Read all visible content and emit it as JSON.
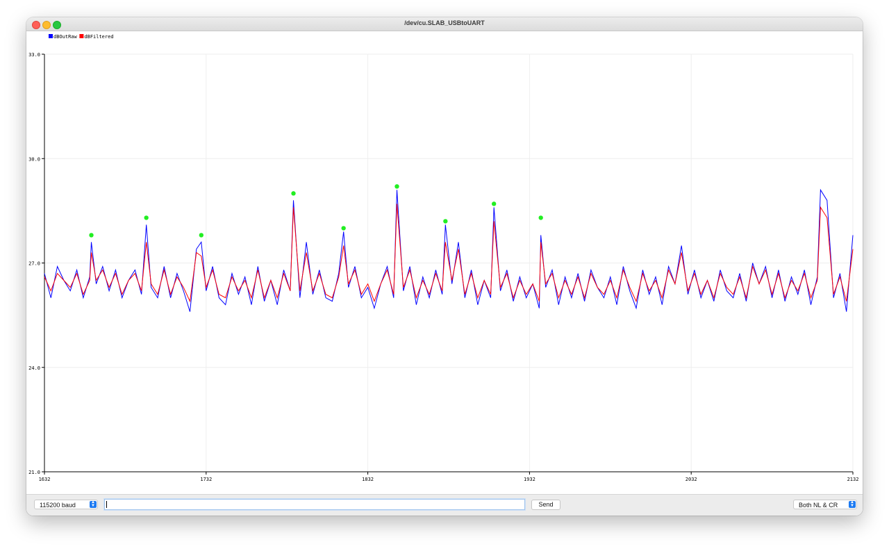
{
  "window": {
    "title": "/dev/cu.SLAB_USBtoUART"
  },
  "toolbar": {
    "baud_label": "115200 baud",
    "input_value": "",
    "send_label": "Send",
    "line_ending_label": "Both NL & CR"
  },
  "chart_data": {
    "type": "line",
    "xlim": [
      1632,
      2132
    ],
    "ylim": [
      21.0,
      33.0
    ],
    "xticks": [
      1632,
      1732,
      1832,
      1932,
      2032,
      2132
    ],
    "yticks": [
      21.0,
      24.0,
      27.0,
      30.0,
      33.0
    ],
    "xtick_labels": [
      "1632",
      "1732",
      "1832",
      "1932",
      "2032",
      "2132"
    ],
    "ytick_labels": [
      "21.0",
      "24.0",
      "27.0",
      "30.0",
      "33.0"
    ],
    "grid": true,
    "legend_position": "top-left",
    "series": [
      {
        "name": "dBOutRaw",
        "color": "#0000ff",
        "x": [
          1632,
          1636,
          1640,
          1644,
          1648,
          1652,
          1656,
          1660,
          1661,
          1664,
          1668,
          1672,
          1676,
          1680,
          1684,
          1688,
          1692,
          1695,
          1698,
          1702,
          1706,
          1710,
          1714,
          1718,
          1722,
          1726,
          1729,
          1732,
          1736,
          1740,
          1744,
          1748,
          1752,
          1756,
          1760,
          1764,
          1768,
          1772,
          1776,
          1780,
          1784,
          1786,
          1790,
          1794,
          1798,
          1802,
          1806,
          1810,
          1814,
          1817,
          1820,
          1824,
          1828,
          1832,
          1836,
          1840,
          1844,
          1848,
          1850,
          1854,
          1858,
          1862,
          1866,
          1870,
          1874,
          1878,
          1880,
          1884,
          1888,
          1892,
          1896,
          1900,
          1904,
          1908,
          1910,
          1914,
          1918,
          1922,
          1926,
          1930,
          1934,
          1938,
          1939,
          1942,
          1946,
          1950,
          1954,
          1958,
          1962,
          1966,
          1970,
          1974,
          1978,
          1982,
          1986,
          1990,
          1994,
          1998,
          2002,
          2006,
          2010,
          2014,
          2018,
          2022,
          2026,
          2030,
          2034,
          2038,
          2042,
          2046,
          2050,
          2054,
          2058,
          2062,
          2066,
          2070,
          2074,
          2078,
          2082,
          2086,
          2090,
          2094,
          2098,
          2102,
          2106,
          2110,
          2112,
          2116,
          2120,
          2124,
          2128,
          2132
        ],
        "values": [
          26.7,
          26.0,
          26.9,
          26.5,
          26.2,
          26.8,
          26.0,
          26.6,
          27.6,
          26.4,
          26.9,
          26.2,
          26.8,
          26.0,
          26.5,
          26.8,
          26.1,
          28.1,
          26.3,
          26.0,
          26.9,
          26.0,
          26.7,
          26.2,
          25.6,
          27.4,
          27.6,
          26.2,
          26.9,
          26.0,
          25.8,
          26.7,
          26.1,
          26.6,
          25.8,
          26.9,
          25.9,
          26.5,
          25.8,
          26.8,
          26.2,
          28.8,
          26.0,
          27.6,
          26.1,
          26.8,
          26.0,
          25.9,
          26.7,
          27.9,
          26.3,
          26.9,
          26.0,
          26.3,
          25.7,
          26.4,
          26.9,
          26.0,
          29.1,
          26.2,
          26.9,
          25.8,
          26.6,
          26.0,
          26.8,
          26.1,
          28.1,
          26.4,
          27.6,
          26.0,
          26.8,
          25.8,
          26.5,
          26.0,
          28.6,
          26.2,
          26.8,
          25.9,
          26.6,
          26.0,
          26.4,
          25.7,
          27.8,
          26.3,
          26.8,
          25.8,
          26.6,
          26.0,
          26.7,
          25.9,
          26.8,
          26.3,
          26.0,
          26.6,
          25.8,
          26.9,
          26.2,
          25.7,
          26.8,
          26.1,
          26.6,
          25.8,
          26.9,
          26.4,
          27.5,
          26.1,
          26.8,
          26.0,
          26.5,
          25.9,
          26.8,
          26.2,
          26.0,
          26.7,
          25.9,
          27.0,
          26.4,
          26.9,
          26.0,
          26.8,
          25.9,
          26.6,
          26.1,
          26.8,
          25.8,
          26.6,
          29.1,
          28.8,
          26.0,
          26.7,
          25.6,
          27.8
        ]
      },
      {
        "name": "dBFiltered",
        "color": "#ff0000",
        "x": [
          1632,
          1636,
          1640,
          1644,
          1648,
          1652,
          1656,
          1660,
          1661,
          1664,
          1668,
          1672,
          1676,
          1680,
          1684,
          1688,
          1692,
          1695,
          1698,
          1702,
          1706,
          1710,
          1714,
          1718,
          1722,
          1726,
          1729,
          1732,
          1736,
          1740,
          1744,
          1748,
          1752,
          1756,
          1760,
          1764,
          1768,
          1772,
          1776,
          1780,
          1784,
          1786,
          1790,
          1794,
          1798,
          1802,
          1806,
          1810,
          1814,
          1817,
          1820,
          1824,
          1828,
          1832,
          1836,
          1840,
          1844,
          1848,
          1850,
          1854,
          1858,
          1862,
          1866,
          1870,
          1874,
          1878,
          1880,
          1884,
          1888,
          1892,
          1896,
          1900,
          1904,
          1908,
          1910,
          1914,
          1918,
          1922,
          1926,
          1930,
          1934,
          1938,
          1939,
          1942,
          1946,
          1950,
          1954,
          1958,
          1962,
          1966,
          1970,
          1974,
          1978,
          1982,
          1986,
          1990,
          1994,
          1998,
          2002,
          2006,
          2010,
          2014,
          2018,
          2022,
          2026,
          2030,
          2034,
          2038,
          2042,
          2046,
          2050,
          2054,
          2058,
          2062,
          2066,
          2070,
          2074,
          2078,
          2082,
          2086,
          2090,
          2094,
          2098,
          2102,
          2106,
          2110,
          2112,
          2116,
          2120,
          2124,
          2128,
          2132
        ],
        "values": [
          26.6,
          26.2,
          26.7,
          26.5,
          26.3,
          26.7,
          26.1,
          26.5,
          27.3,
          26.5,
          26.8,
          26.3,
          26.7,
          26.1,
          26.5,
          26.7,
          26.2,
          27.6,
          26.4,
          26.1,
          26.8,
          26.1,
          26.6,
          26.3,
          25.9,
          27.3,
          27.2,
          26.3,
          26.8,
          26.1,
          26.0,
          26.6,
          26.2,
          26.5,
          26.0,
          26.8,
          26.0,
          26.5,
          26.0,
          26.7,
          26.2,
          28.6,
          26.2,
          27.3,
          26.2,
          26.7,
          26.1,
          26.0,
          26.6,
          27.5,
          26.4,
          26.8,
          26.1,
          26.4,
          25.9,
          26.4,
          26.8,
          26.1,
          28.7,
          26.3,
          26.8,
          26.0,
          26.5,
          26.1,
          26.7,
          26.2,
          27.6,
          26.5,
          27.4,
          26.1,
          26.7,
          26.0,
          26.5,
          26.1,
          28.2,
          26.3,
          26.7,
          26.0,
          26.5,
          26.1,
          26.4,
          25.9,
          27.6,
          26.4,
          26.7,
          26.0,
          26.5,
          26.1,
          26.6,
          26.0,
          26.7,
          26.3,
          26.1,
          26.5,
          26.0,
          26.8,
          26.3,
          25.9,
          26.7,
          26.2,
          26.5,
          26.0,
          26.8,
          26.4,
          27.3,
          26.2,
          26.7,
          26.1,
          26.5,
          26.0,
          26.7,
          26.3,
          26.1,
          26.6,
          26.0,
          26.9,
          26.4,
          26.8,
          26.1,
          26.7,
          26.0,
          26.5,
          26.2,
          26.7,
          26.0,
          26.5,
          28.6,
          28.3,
          26.1,
          26.6,
          25.9,
          27.4
        ]
      }
    ],
    "markers": {
      "color": "#22ee22",
      "points": [
        [
          1661,
          27.8
        ],
        [
          1695,
          28.3
        ],
        [
          1729,
          27.8
        ],
        [
          1786,
          29.0
        ],
        [
          1817,
          28.0
        ],
        [
          1850,
          29.2
        ],
        [
          1880,
          28.2
        ],
        [
          1910,
          28.7
        ],
        [
          1939,
          28.3
        ]
      ]
    }
  }
}
